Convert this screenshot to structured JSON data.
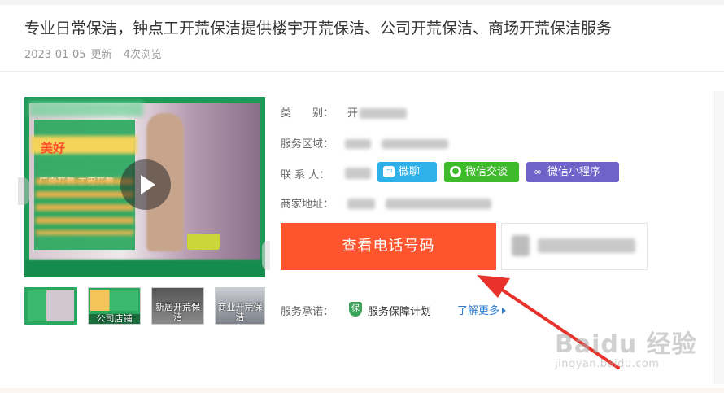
{
  "header": {
    "title": "专业日常保洁，钟点工开荒保洁提供楼宇开荒保洁、公司开荒保洁、商场开荒保洁服务",
    "date": "2023-01-05",
    "updated_label": "更新",
    "views": "4次浏览"
  },
  "media": {
    "video_banner_text": "美好",
    "video_overlay_text": "厂房开荒 工程开荒",
    "thumbnails": [
      {
        "caption": ""
      },
      {
        "caption": "公司店铺"
      },
      {
        "caption": "新居开荒保洁"
      },
      {
        "caption": "商业开荒保洁"
      }
    ]
  },
  "info": {
    "category_label": "类　　别：",
    "category_value_visible": "开",
    "region_label": "服务区域：",
    "contact_label": "联 系 人：",
    "address_label": "商家地址：",
    "chat_buttons": [
      {
        "label": "微聊",
        "icon": "chat-bubble-icon",
        "color": "#2eb0e8"
      },
      {
        "label": "微信交谈",
        "icon": "wechat-icon",
        "color": "#3dbb2a"
      },
      {
        "label": "微信小程序",
        "icon": "mini-program-icon",
        "color": "#6f63c9"
      }
    ],
    "phone_button_label": "查看电话号码",
    "promise_label": "服务承诺：",
    "promise_badge": "保",
    "promise_text": "服务保障计划",
    "learn_more": "了解更多"
  },
  "watermark": {
    "brand": "Baidu 经验",
    "url": "jingyan.baidu.com"
  },
  "colors": {
    "phone_button": "#ff552e",
    "link": "#2b7ccf"
  }
}
